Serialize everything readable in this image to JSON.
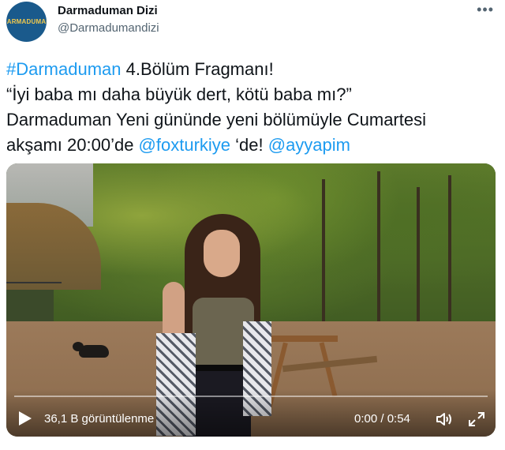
{
  "user": {
    "avatar_text": "Darmaduman",
    "display_name": "Darmaduman Dizi",
    "handle": "@Darmadumandizi"
  },
  "more_label": "•••",
  "tweet": {
    "hashtag": "#Darmaduman",
    "line1_rest": " 4.Bölüm Fragmanı!",
    "line2": "“İyi baba mı daha büyük dert, kötü baba mı?”",
    "line3": "Darmaduman Yeni gününde yeni bölümüyle Cumartesi",
    "line4_pre": "akşamı 20:00’de ",
    "mention1": "@foxturkiye",
    "line4_mid": " ‘de! ",
    "mention2": "@ayyapim"
  },
  "video": {
    "views": "36,1 B görüntülenme",
    "time": "0:00 / 0:54"
  },
  "icons": {
    "play": "play-icon",
    "volume": "volume-icon",
    "fullscreen": "fullscreen-icon"
  },
  "colors": {
    "link": "#1d9bf0",
    "text": "#0f1419",
    "secondary": "#536471"
  }
}
